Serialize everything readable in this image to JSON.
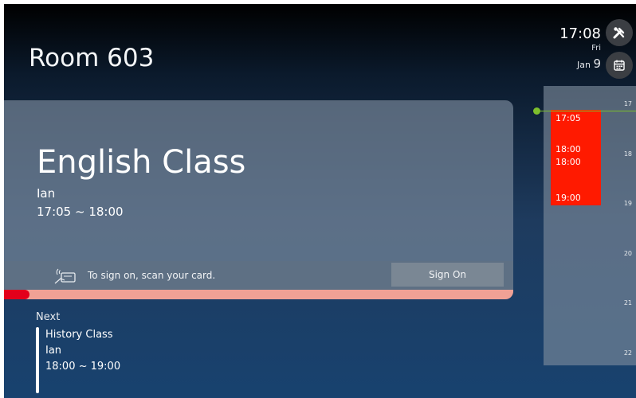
{
  "header": {
    "room_name": "Room 603",
    "time": "17:08",
    "day": "Fri",
    "month": "Jan",
    "date": "9"
  },
  "icons": {
    "tools": "tools-icon",
    "calendar": "calendar-icon",
    "card_scan": "card-scan-icon"
  },
  "current_event": {
    "title": "English Class",
    "organizer": "Ian",
    "time_range": "17:05 ~ 18:00",
    "elapsed_fraction": 0.05
  },
  "sign_on": {
    "prompt": "To sign on, scan your card.",
    "button_label": "Sign On"
  },
  "next_event": {
    "section_label": "Next",
    "title": "History Class",
    "organizer": "Ian",
    "time_range": "18:00 ~ 19:00"
  },
  "timeline": {
    "hours": [
      "17",
      "18",
      "19",
      "20",
      "21",
      "22"
    ],
    "block_times": [
      "17:05",
      "18:00",
      "18:00",
      "19:00"
    ]
  },
  "colors": {
    "active_event": "#ff1a00",
    "progress_fill": "#e3001b",
    "progress_track": "#f0a195",
    "now_indicator": "#7dbf2c"
  }
}
